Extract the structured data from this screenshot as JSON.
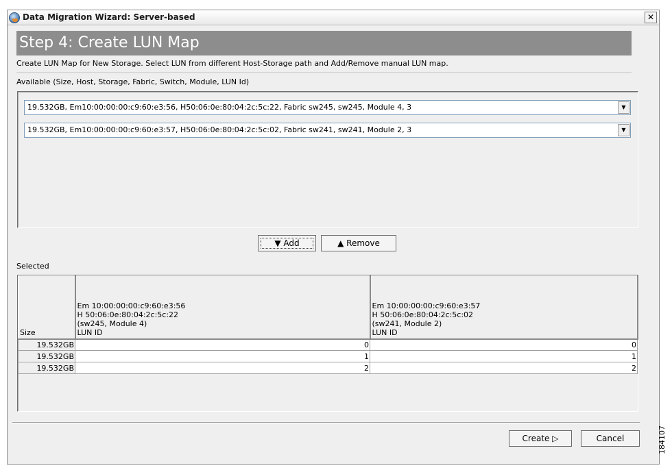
{
  "window": {
    "title": "Data Migration Wizard: Server-based",
    "close_glyph": "✕"
  },
  "step": {
    "title": "Step 4: Create LUN Map",
    "description": "Create LUN Map for New Storage. Select LUN from different Host-Storage path and Add/Remove manual LUN map."
  },
  "available": {
    "label": "Available (Size, Host, Storage, Fabric, Switch, Module, LUN Id)",
    "items": [
      "19.532GB, Em10:00:00:00:c9:60:e3:56, H50:06:0e:80:04:2c:5c:22, Fabric sw245, sw245, Module 4, 3",
      "19.532GB, Em10:00:00:00:c9:60:e3:57, H50:06:0e:80:04:2c:5c:02, Fabric sw241, sw241, Module 2, 3"
    ]
  },
  "actions": {
    "add_label": "▼ Add",
    "remove_label": "▲ Remove"
  },
  "selected": {
    "label": "Selected",
    "columns": [
      {
        "lines": [
          "Size"
        ]
      },
      {
        "lines": [
          "Em 10:00:00:00:c9:60:e3:56",
          "H 50:06:0e:80:04:2c:5c:22",
          "(sw245, Module 4)",
          "LUN ID"
        ]
      },
      {
        "lines": [
          "Em 10:00:00:00:c9:60:e3:57",
          "H 50:06:0e:80:04:2c:5c:02",
          "(sw241, Module 2)",
          "LUN ID"
        ]
      }
    ],
    "rows": [
      [
        "19.532GB",
        "0",
        "0"
      ],
      [
        "19.532GB",
        "1",
        "1"
      ],
      [
        "19.532GB",
        "2",
        "2"
      ]
    ]
  },
  "footer": {
    "create_label": "Create ▷",
    "cancel_label": "Cancel"
  },
  "figure_id": "184107"
}
